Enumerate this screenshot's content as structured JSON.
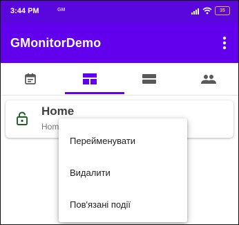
{
  "status_bar": {
    "time": "3:44 PM",
    "notification": "GM",
    "battery": "35",
    "icons": [
      "signal-icon",
      "wifi-icon",
      "battery-icon"
    ]
  },
  "app_bar": {
    "title": "GMonitorDemo",
    "menu_icon": "more-vert-icon"
  },
  "tabs": [
    {
      "icon": "calendar-icon",
      "selected": false
    },
    {
      "icon": "dashboard-icon",
      "selected": true
    },
    {
      "icon": "list-icon",
      "selected": false
    },
    {
      "icon": "people-icon",
      "selected": false
    }
  ],
  "card": {
    "title": "Home",
    "subtitle": "Hom",
    "icon": "lock-open-icon"
  },
  "popup_menu": {
    "items": [
      {
        "label": "Перейменувати"
      },
      {
        "label": "Видалити"
      },
      {
        "label": "Пов'язані події"
      }
    ]
  },
  "colors": {
    "primary": "#6200ee",
    "status_bar": "#5a07de",
    "tab_icon": "#595959",
    "lock_icon": "#1b5e20",
    "battery": "#e8b838"
  }
}
